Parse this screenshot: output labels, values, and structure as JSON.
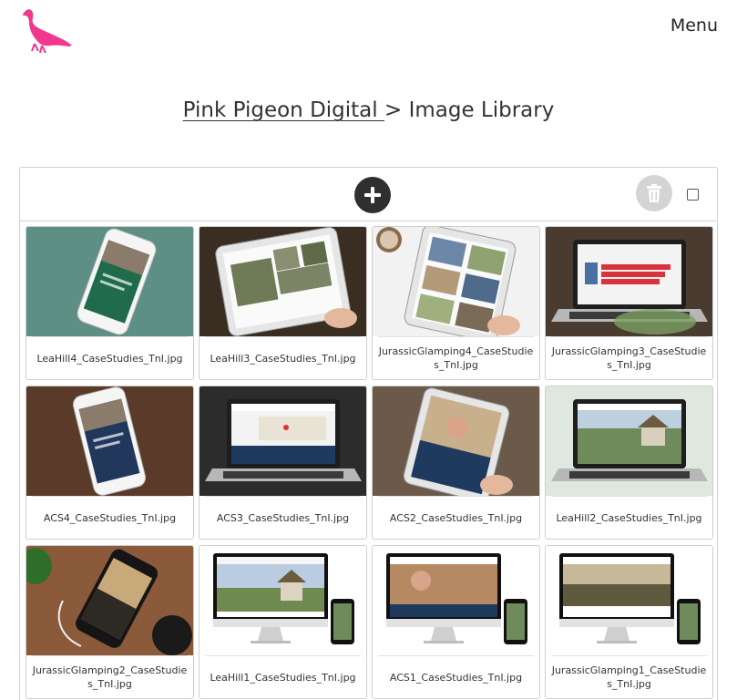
{
  "header": {
    "logo_icon": "pigeon-icon",
    "brand_color": "#f0388e",
    "menu_label": "Menu"
  },
  "breadcrumb": {
    "home_label": "Pink Pigeon Digital ",
    "separator": ">",
    "current": "Image Library"
  },
  "toolbar": {
    "add_icon": "plus-circle-icon",
    "delete_icon": "trash-icon",
    "select_all_checked": false
  },
  "images": [
    {
      "filename": "LeaHill4_CaseStudies_TnI.jpg",
      "scene": "phone-green"
    },
    {
      "filename": "LeaHill3_CaseStudies_TnI.jpg",
      "scene": "tablet-grey"
    },
    {
      "filename": "JurassicGlamping4_CaseStudies_TnI.jpg",
      "scene": "tablet-gallery"
    },
    {
      "filename": "JurassicGlamping3_CaseStudies_TnI.jpg",
      "scene": "laptop-red"
    },
    {
      "filename": "ACS4_CaseStudies_TnI.jpg",
      "scene": "phone-blue"
    },
    {
      "filename": "ACS3_CaseStudies_TnI.jpg",
      "scene": "laptop-map"
    },
    {
      "filename": "ACS2_CaseStudies_TnI.jpg",
      "scene": "tablet-person"
    },
    {
      "filename": "LeaHill2_CaseStudies_TnI.jpg",
      "scene": "laptop-cottage"
    },
    {
      "filename": "JurassicGlamping2_CaseStudies_TnI.jpg",
      "scene": "phone-dark"
    },
    {
      "filename": "LeaHill1_CaseStudies_TnI.jpg",
      "scene": "imac-cottage"
    },
    {
      "filename": "ACS1_CaseStudies_TnI.jpg",
      "scene": "imac-person"
    },
    {
      "filename": "JurassicGlamping1_CaseStudies_TnI.jpg",
      "scene": "imac-landscape"
    }
  ]
}
